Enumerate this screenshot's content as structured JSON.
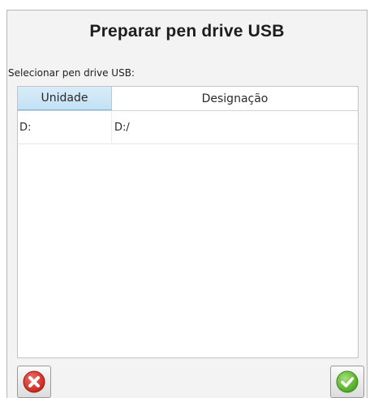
{
  "dialog": {
    "title": "Preparar pen drive USB",
    "subtitle": "Selecionar pen drive USB:"
  },
  "table": {
    "headers": [
      "Unidade",
      "Designação"
    ],
    "rows": [
      {
        "drive": "D:",
        "designation": "D:/"
      }
    ]
  },
  "buttons": {
    "cancel_icon": "cancel-x-icon",
    "confirm_icon": "confirm-check-icon"
  },
  "colors": {
    "cancel_red": "#d9352b",
    "confirm_green": "#5cb82e",
    "header_selected": "#c2e1f5"
  }
}
